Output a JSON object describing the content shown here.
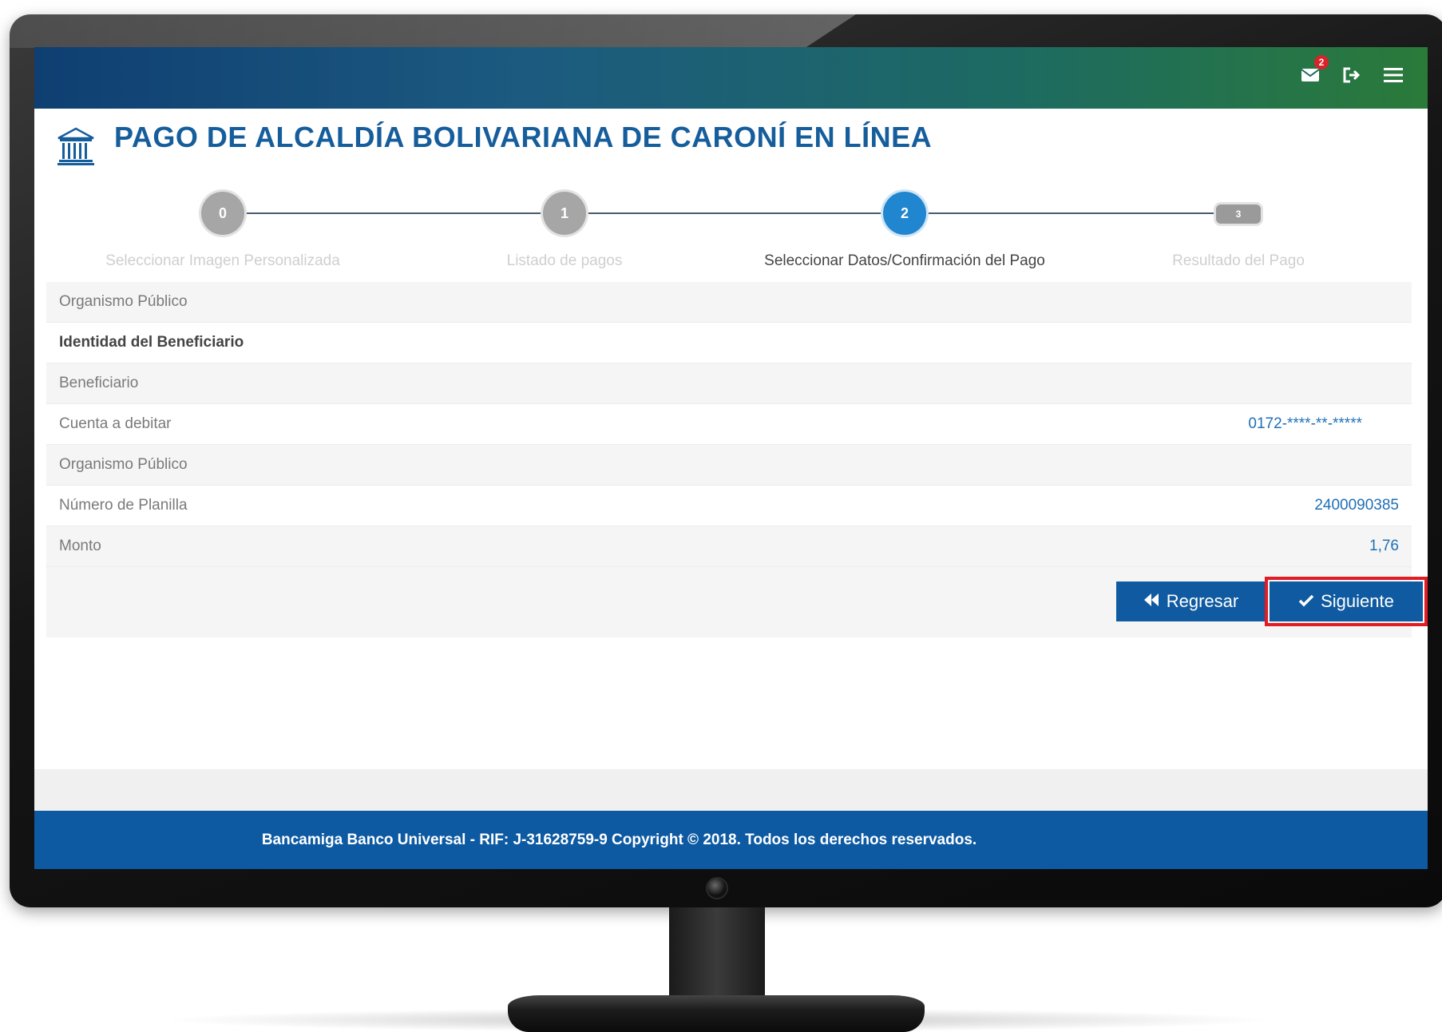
{
  "header": {
    "title": "PAGO DE ALCALDÍA BOLIVARIANA DE CARONÍ EN LÍNEA",
    "notification_count": "2",
    "icons": [
      "envelope-icon",
      "logout-icon",
      "menu-icon"
    ]
  },
  "stepper": {
    "steps": [
      {
        "number": "0",
        "label": "Seleccionar Imagen Personalizada",
        "state": "done"
      },
      {
        "number": "1",
        "label": "Listado de pagos",
        "state": "done"
      },
      {
        "number": "2",
        "label": "Seleccionar Datos/Confirmación del Pago",
        "state": "active"
      },
      {
        "number": "3",
        "label": "Resultado del Pago",
        "state": "pending"
      }
    ]
  },
  "details": {
    "rows": [
      {
        "label": "Organismo Público",
        "value": ""
      },
      {
        "label": "Identidad del Beneficiario",
        "value": ""
      },
      {
        "label": "Beneficiario",
        "value": ""
      },
      {
        "label": "Cuenta a debitar",
        "value": "0172-****-**-*****"
      },
      {
        "label": "Organismo Público",
        "value": ""
      },
      {
        "label": "Número de Planilla",
        "value": "2400090385"
      },
      {
        "label": "Monto",
        "value": "1,76"
      }
    ]
  },
  "actions": {
    "back_label": "Regresar",
    "next_label": "Siguiente"
  },
  "footer": {
    "text": "Bancamiga Banco Universal - RIF: J-31628759-9 Copyright © 2018. Todos los derechos reservados."
  },
  "colors": {
    "primary": "#0f5aa0",
    "title": "#165d9c",
    "active_step": "#1f86cf",
    "highlight": "#e21c24"
  }
}
